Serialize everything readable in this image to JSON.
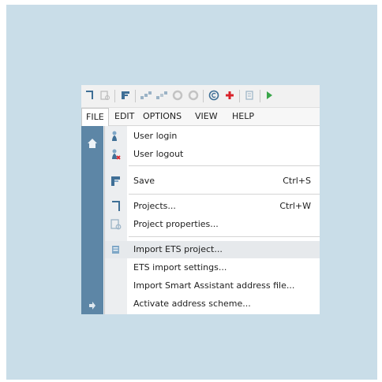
{
  "menubar": {
    "file": "FILE",
    "edit": "EDIT",
    "options": "OPTIONS",
    "view": "VIEW",
    "help": "HELP"
  },
  "toolbar": {
    "icons": [
      "document-icon",
      "document-properties-icon",
      "import-icon",
      "connect-icon",
      "disconnect-icon",
      "disabled-circle-icon",
      "disabled-circle-icon",
      "copyright-icon",
      "add-icon",
      "properties-icon",
      "play-icon"
    ]
  },
  "file_menu": {
    "items": [
      {
        "label": "User login",
        "shortcut": "",
        "icon": "user-login-icon"
      },
      {
        "label": "User logout",
        "shortcut": "",
        "icon": "user-logout-icon"
      },
      {
        "label": "Save",
        "shortcut": "Ctrl+S",
        "icon": "save-icon"
      },
      {
        "label": "Projects...",
        "shortcut": "Ctrl+W",
        "icon": "projects-icon"
      },
      {
        "label": "Project properties...",
        "shortcut": "",
        "icon": "project-properties-icon"
      },
      {
        "label": "Import ETS project...",
        "shortcut": "",
        "icon": "import-ets-icon",
        "highlighted": true
      },
      {
        "label": "ETS import settings...",
        "shortcut": "",
        "icon": ""
      },
      {
        "label": "Import Smart Assistant address file...",
        "shortcut": "",
        "icon": ""
      },
      {
        "label": "Activate address scheme...",
        "shortcut": "",
        "icon": ""
      }
    ]
  },
  "colors": {
    "panel_bg": "#c9dde8",
    "sidebar": "#5d86a6",
    "highlight": "#e6e9ec",
    "add_red": "#d9232a",
    "play_green": "#3aa64a"
  }
}
